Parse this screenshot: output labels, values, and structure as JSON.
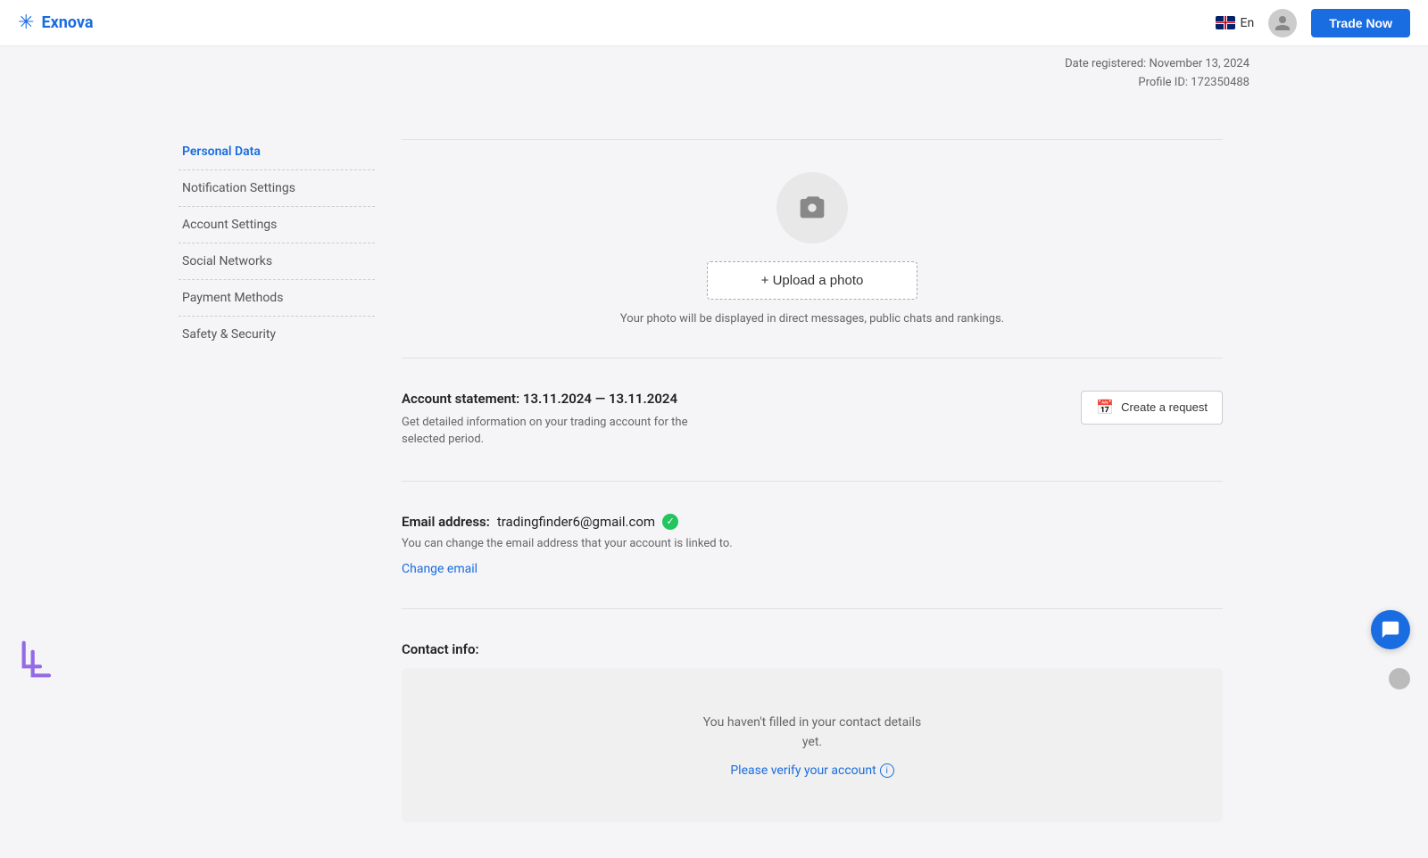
{
  "header": {
    "logo_text": "Exnova",
    "language": "En",
    "trade_now_label": "Trade Now"
  },
  "meta": {
    "date_registered_label": "Date registered:",
    "date_registered_value": "November 13, 2024",
    "profile_id_label": "Profile ID:",
    "profile_id_value": "172350488"
  },
  "sidebar": {
    "items": [
      {
        "id": "personal-data",
        "label": "Personal Data",
        "active": true
      },
      {
        "id": "notification-settings",
        "label": "Notification Settings",
        "active": false
      },
      {
        "id": "account-settings",
        "label": "Account Settings",
        "active": false
      },
      {
        "id": "social-networks",
        "label": "Social Networks",
        "active": false
      },
      {
        "id": "payment-methods",
        "label": "Payment Methods",
        "active": false
      },
      {
        "id": "safety-security",
        "label": "Safety & Security",
        "active": false
      }
    ]
  },
  "photo_section": {
    "upload_label": "+ Upload a photo",
    "hint": "Your photo will be displayed in direct messages, public chats and rankings."
  },
  "statement_section": {
    "title": "Account statement:  13.11.2024 — 13.11.2024",
    "description_line1": "Get detailed information on your trading account for the",
    "description_line2": "selected period.",
    "create_request_label": "Create a request"
  },
  "email_section": {
    "label": "Email address:",
    "value": "tradingfinder6@gmail.com",
    "hint": "You can change the email address that your account is linked to.",
    "change_link": "Change email"
  },
  "contact_section": {
    "title": "Contact info:",
    "empty_text_line1": "You haven't filled in your contact details",
    "empty_text_line2": "yet.",
    "verify_link": "Please verify your account"
  }
}
